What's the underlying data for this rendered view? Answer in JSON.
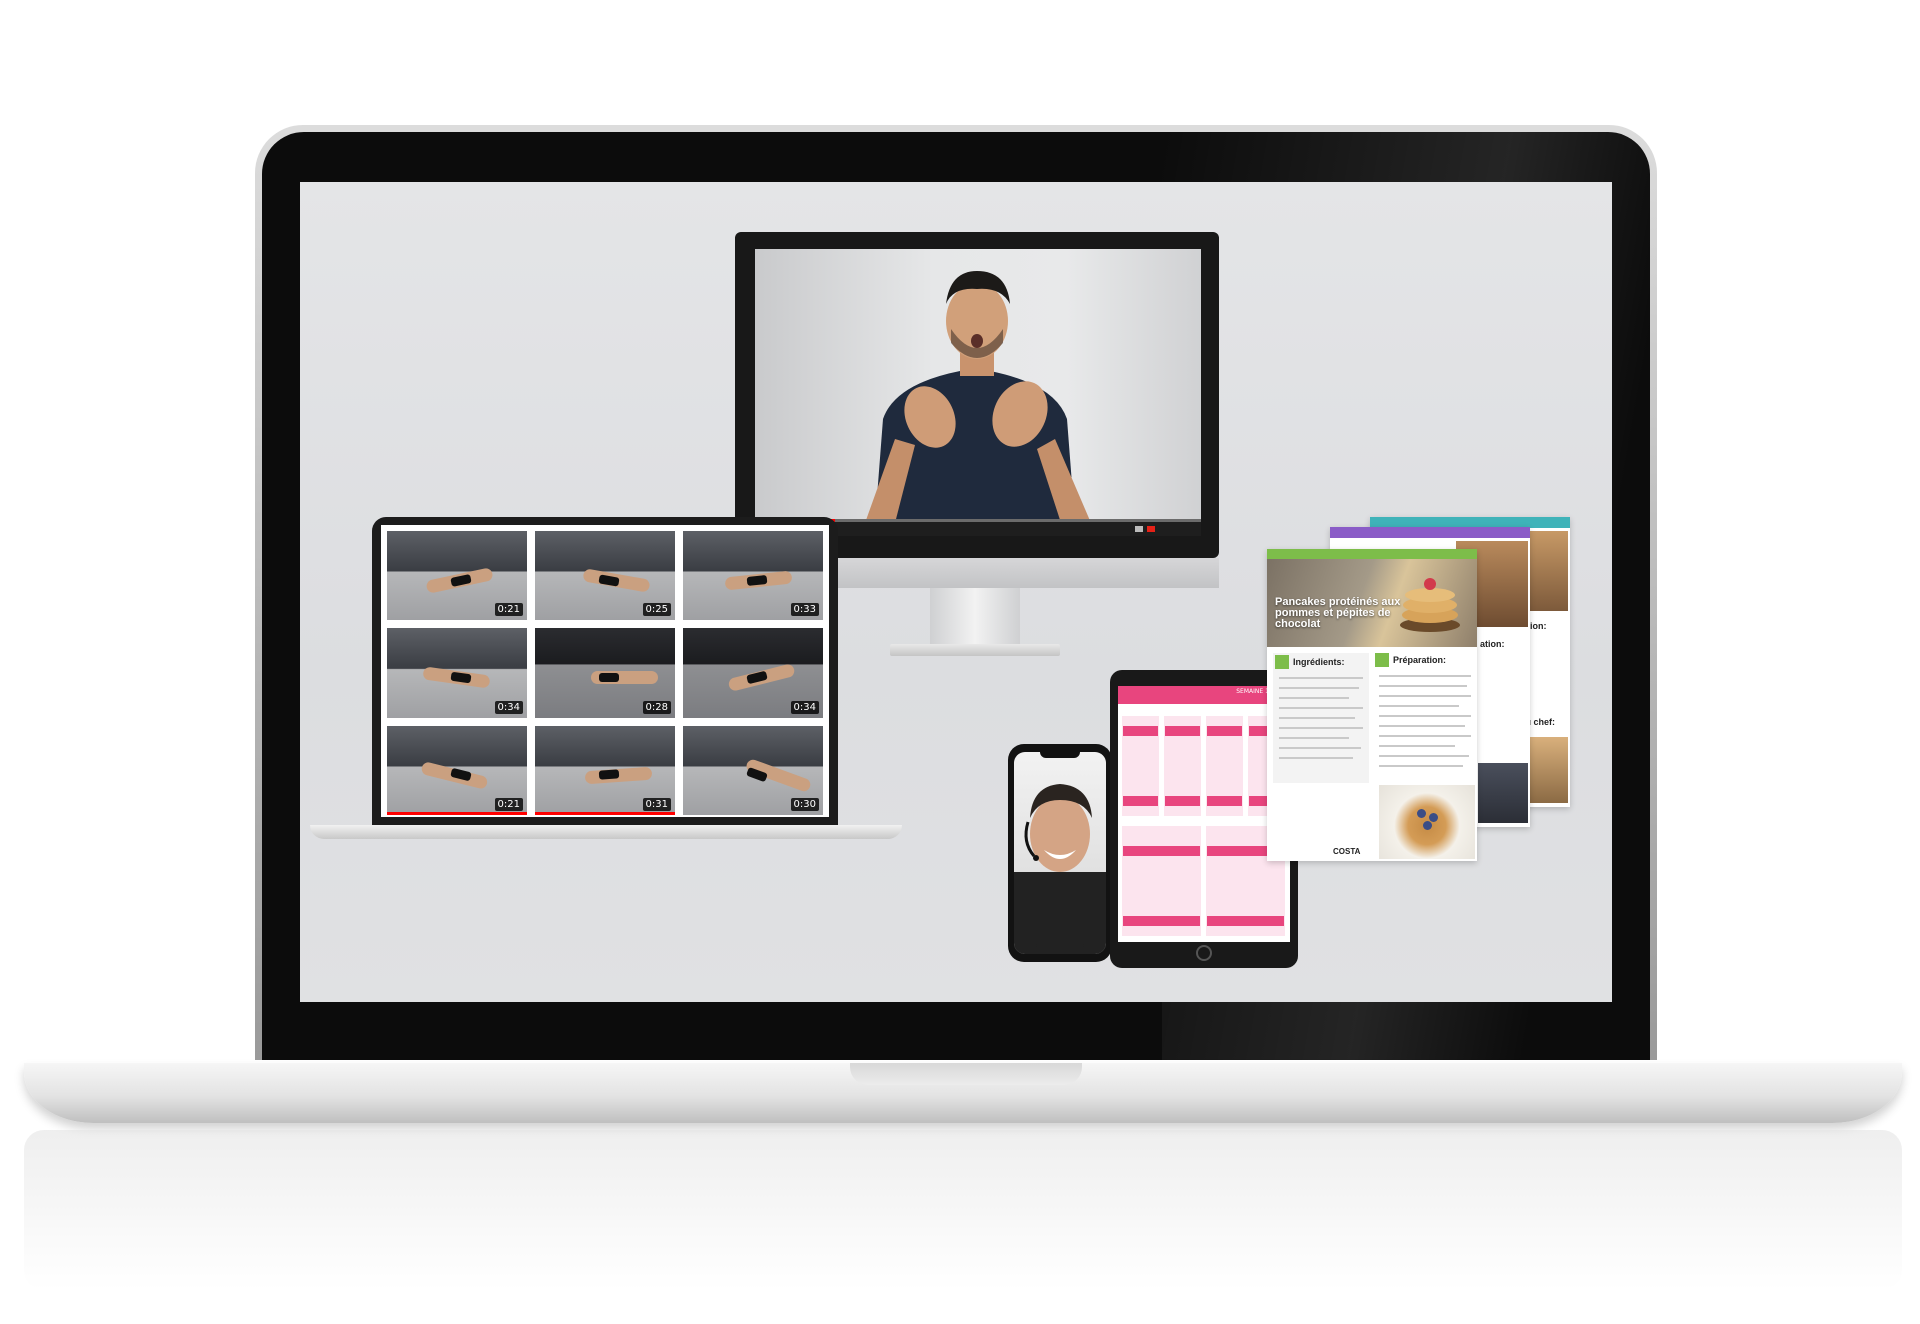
{
  "monitor_video": {
    "subject": "instructor-talking",
    "progress_fraction": 0.18
  },
  "thumbnails": [
    {
      "duration": "0:21",
      "watched": 0
    },
    {
      "duration": "0:25",
      "watched": 0
    },
    {
      "duration": "0:33",
      "watched": 0
    },
    {
      "duration": "0:34",
      "watched": 0
    },
    {
      "duration": "0:28",
      "watched": 0
    },
    {
      "duration": "0:34",
      "watched": 0
    },
    {
      "duration": "0:21",
      "watched": 1
    },
    {
      "duration": "0:31",
      "watched": 1
    },
    {
      "duration": "0:30",
      "watched": 0
    }
  ],
  "tablet": {
    "header": "SEMAINE 1 ET 2"
  },
  "recipe": {
    "title": "Pancakes protéinés aux pommes et pépites de chocolat",
    "ingredients_heading": "Ingrédients:",
    "preparation_heading": "Préparation:",
    "brand": "COSTA"
  },
  "back_cards": [
    {
      "heading": "ation:"
    },
    {
      "heading": "ation:"
    },
    {
      "heading": "du chef:"
    }
  ],
  "colors": {
    "youtube_red": "#e62117",
    "tablet_pink": "#e8457e",
    "recipe_green": "#7dbd4a",
    "recipe_purple": "#8a5cc7",
    "recipe_teal": "#3fb3b9"
  }
}
